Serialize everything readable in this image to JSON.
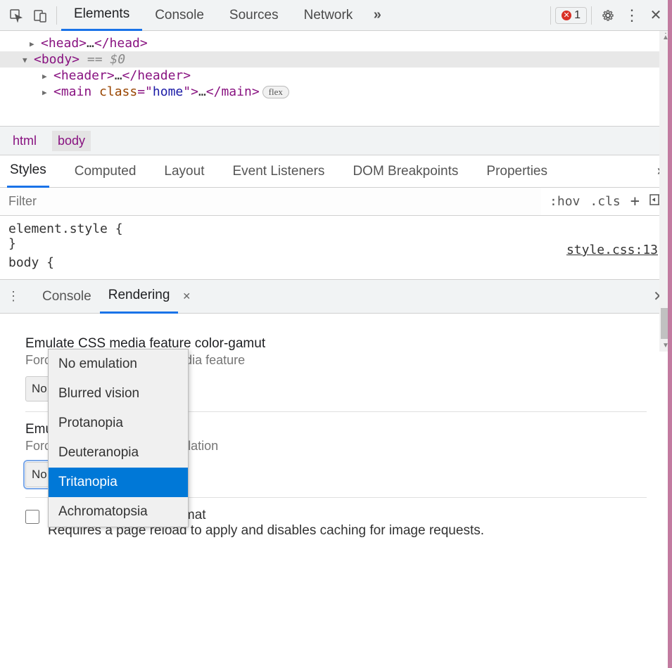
{
  "topTabs": {
    "elements": "Elements",
    "console": "Console",
    "sources": "Sources",
    "network": "Network"
  },
  "errorCount": "1",
  "dom": {
    "headOpen": "<head>",
    "headDots": "…",
    "headClose": "</head>",
    "bodyOpen": "<body>",
    "bodyEq": " == $0",
    "headerOpen": "<header>",
    "headerDots": "…",
    "headerClose": "</header>",
    "mainOpen1": "<main ",
    "mainAttr": "class",
    "mainEq2": "=\"",
    "mainVal": "home",
    "mainOpen2": "\">",
    "mainDots": "…",
    "mainClose": "</main>",
    "flexBadge": "flex"
  },
  "crumbs": {
    "html": "html",
    "body": "body"
  },
  "styleTabs": {
    "styles": "Styles",
    "computed": "Computed",
    "layout": "Layout",
    "events": "Event Listeners",
    "dombp": "DOM Breakpoints",
    "props": "Properties"
  },
  "filter": {
    "placeholder": "Filter",
    "hov": ":hov",
    "cls": ".cls"
  },
  "styles": {
    "elstyle": "element.style {",
    "close": "}",
    "body": "body {",
    "src": "style.css:13"
  },
  "drawerTabs": {
    "console": "Console",
    "rendering": "Rendering"
  },
  "r1": {
    "title": "Emulate CSS media feature color-gamut",
    "desc": "Forces CSS color-gamut media feature",
    "sel": "No emulation"
  },
  "r2": {
    "title": "Emulate vision deficiencies",
    "desc": "Forces vision deficiency emulation",
    "sel": "No emulation"
  },
  "r3": {
    "title": "Disable AVIF image format",
    "desc": "Requires a page reload to apply and disables caching for image requests."
  },
  "opts": {
    "o0": "No emulation",
    "o1": "Blurred vision",
    "o2": "Protanopia",
    "o3": "Deuteranopia",
    "o4": "Tritanopia",
    "o5": "Achromatopsia"
  }
}
